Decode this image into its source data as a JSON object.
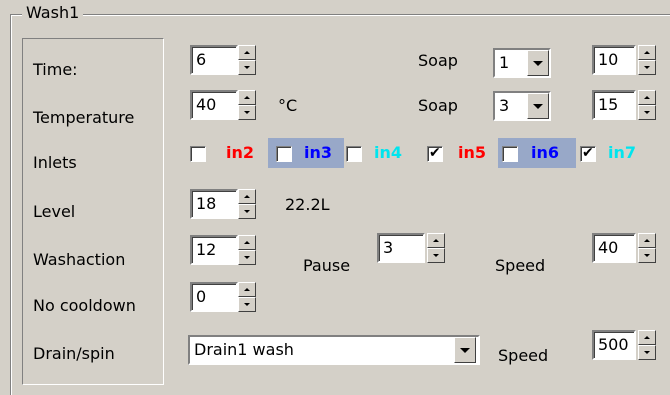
{
  "group": {
    "title": "Wash1"
  },
  "labels": {
    "time": "Time:",
    "temperature": "Temperature",
    "inlets": "Inlets",
    "level": "Level",
    "washaction": "Washaction",
    "no_cooldown": "No cooldown",
    "drain_spin": "Drain/spin"
  },
  "time": {
    "value": "6",
    "soap_label": "Soap",
    "soap_value": "1",
    "soap_amount": "10"
  },
  "temperature": {
    "value": "40",
    "unit": "°C",
    "soap_label": "Soap",
    "soap_value": "3",
    "soap_amount": "15"
  },
  "inlets": [
    {
      "label": "in2",
      "checked": false,
      "color": "#ff0000"
    },
    {
      "label": "in3",
      "checked": false,
      "color": "#0000ff"
    },
    {
      "label": "in4",
      "checked": false,
      "color": "#00e5ee"
    },
    {
      "label": "in5",
      "checked": true,
      "color": "#ff0000"
    },
    {
      "label": "in6",
      "checked": false,
      "color": "#0000ff"
    },
    {
      "label": "in7",
      "checked": true,
      "color": "#00e5ee"
    }
  ],
  "level": {
    "value": "18",
    "liters": "22.2L"
  },
  "washaction": {
    "value": "12",
    "pause_label": "Pause",
    "pause_value": "3",
    "speed_label": "Speed",
    "speed_value": "40"
  },
  "no_cooldown": {
    "value": "0"
  },
  "drain": {
    "program": "Drain1 wash",
    "speed_label": "Speed",
    "speed_value": "500"
  },
  "colors": {
    "background": "#d4d0c8",
    "highlight": "#98a8c8"
  }
}
